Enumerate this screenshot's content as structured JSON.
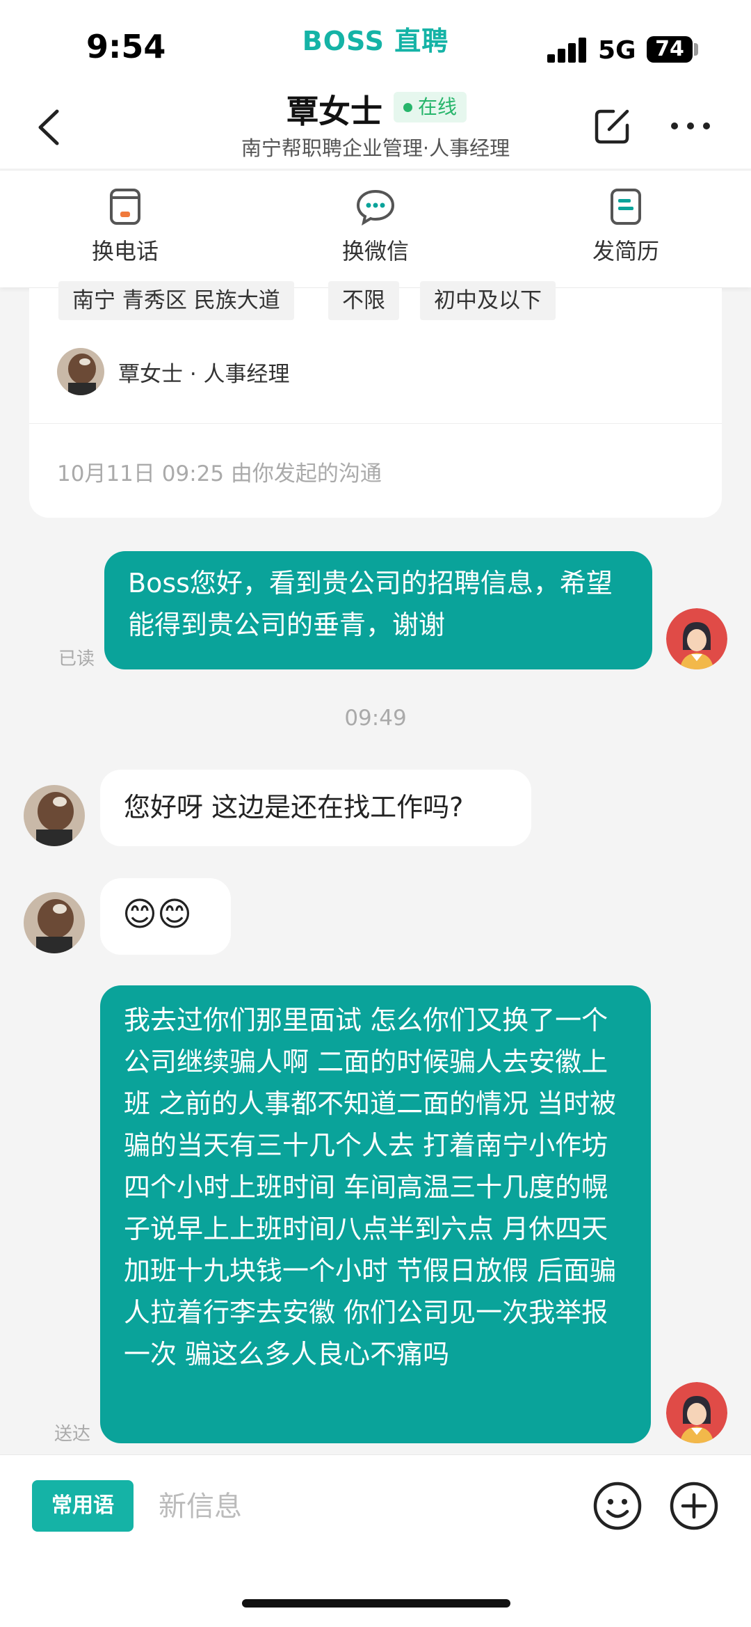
{
  "status_bar": {
    "time": "9:54",
    "brand": "BOSS 直聘",
    "network": "5G",
    "battery": "74"
  },
  "header": {
    "name": "覃女士",
    "online": "在线",
    "subtitle": "南宁帮职聘企业管理·人事经理"
  },
  "actions": [
    {
      "label": "换电话",
      "icon": "phone-card-icon",
      "color": "#f07a3c"
    },
    {
      "label": "换微信",
      "icon": "wechat-bubble-icon",
      "color": "#0aa39a"
    },
    {
      "label": "发简历",
      "icon": "resume-icon",
      "color": "#0aa39a"
    }
  ],
  "job_card": {
    "tags": [
      "南宁 青秀区 民族大道",
      "不限",
      "初中及以下"
    ],
    "person": "覃女士 · 人事经理",
    "started": "10月11日 09:25 由你发起的沟通"
  },
  "messages": {
    "m1": "Boss您好，看到贵公司的招聘信息，希望能得到贵公司的垂青，谢谢",
    "m1_status": "已读",
    "time2": "09:49",
    "m2": "您好呀 这边是还在找工作吗?",
    "m3": "😊😊",
    "m4": "我去过你们那里面试 怎么你们又换了一个公司继续骗人啊 二面的时候骗人去安徽上班 之前的人事都不知道二面的情况 当时被骗的当天有三十几个人去 打着南宁小作坊四个小时上班时间 车间高温三十几度的幌子说早上上班时间八点半到六点 月休四天 加班十九块钱一个小时 节假日放假 后面骗人拉着行李去安徽 你们公司见一次我举报一次 骗这么多人良心不痛吗",
    "m4_status": "送达"
  },
  "input": {
    "phrases": "常用语",
    "placeholder": "新信息"
  },
  "colors": {
    "brand": "#15b3a6",
    "bubble_me": "#0aa39a",
    "online": "#27b56b"
  }
}
